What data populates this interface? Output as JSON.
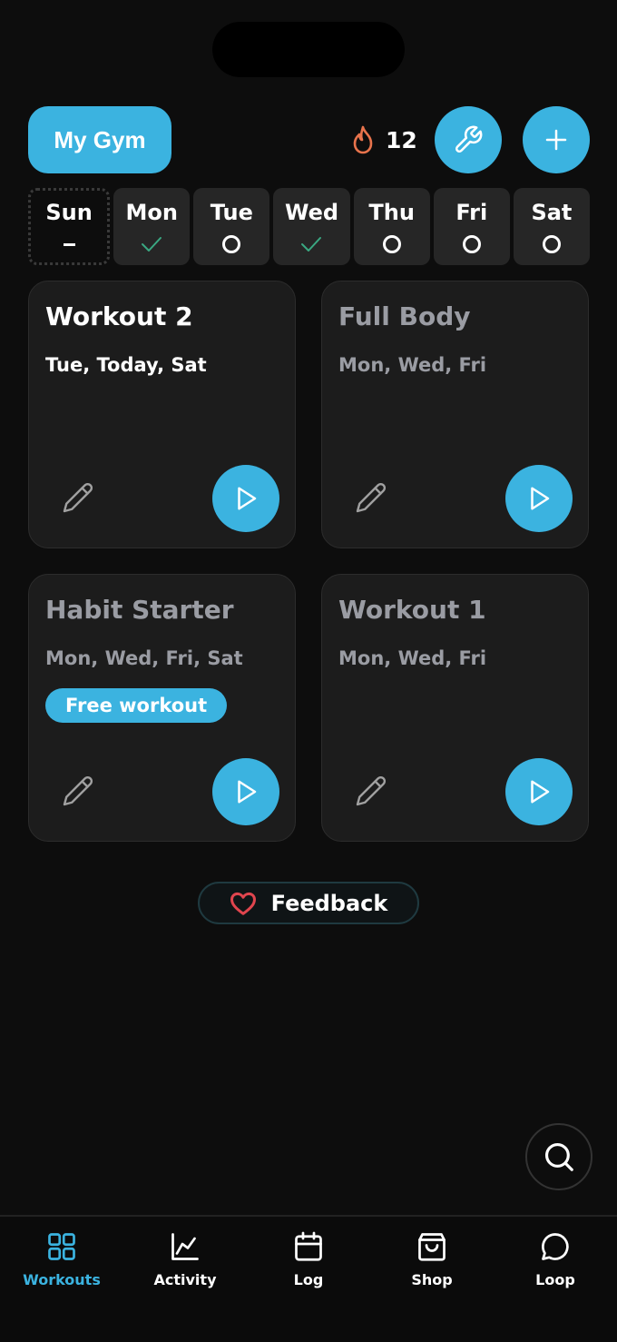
{
  "header": {
    "gym_label": "My Gym",
    "streak_count": "12",
    "icons": {
      "streak": "flame-icon",
      "settings": "wrench-icon",
      "add": "plus-icon"
    }
  },
  "colors": {
    "accent": "#3bb3e0",
    "done_check": "#3aa882",
    "flame": "#e8734c",
    "heart": "#e0454e"
  },
  "week": [
    {
      "label": "Sun",
      "status": "none",
      "today": true
    },
    {
      "label": "Mon",
      "status": "done"
    },
    {
      "label": "Tue",
      "status": "planned"
    },
    {
      "label": "Wed",
      "status": "done"
    },
    {
      "label": "Thu",
      "status": "planned"
    },
    {
      "label": "Fri",
      "status": "planned"
    },
    {
      "label": "Sat",
      "status": "planned"
    }
  ],
  "workouts": [
    {
      "title": "Workout 2",
      "days": "Tue, Today, Sat",
      "active": true
    },
    {
      "title": "Full Body",
      "days": "Mon, Wed, Fri",
      "active": false
    },
    {
      "title": "Habit Starter",
      "days": "Mon, Wed, Fri, Sat",
      "active": false,
      "badge": "Free workout"
    },
    {
      "title": "Workout 1",
      "days": "Mon, Wed, Fri",
      "active": false
    }
  ],
  "feedback": {
    "label": "Feedback",
    "icon": "heart-icon"
  },
  "search": {
    "icon": "search-icon"
  },
  "tabs": [
    {
      "label": "Workouts",
      "icon": "grid-icon",
      "active": true
    },
    {
      "label": "Activity",
      "icon": "chart-icon",
      "active": false
    },
    {
      "label": "Log",
      "icon": "calendar-icon",
      "active": false
    },
    {
      "label": "Shop",
      "icon": "bag-icon",
      "active": false
    },
    {
      "label": "Loop",
      "icon": "chat-bubble-icon",
      "active": false
    }
  ]
}
